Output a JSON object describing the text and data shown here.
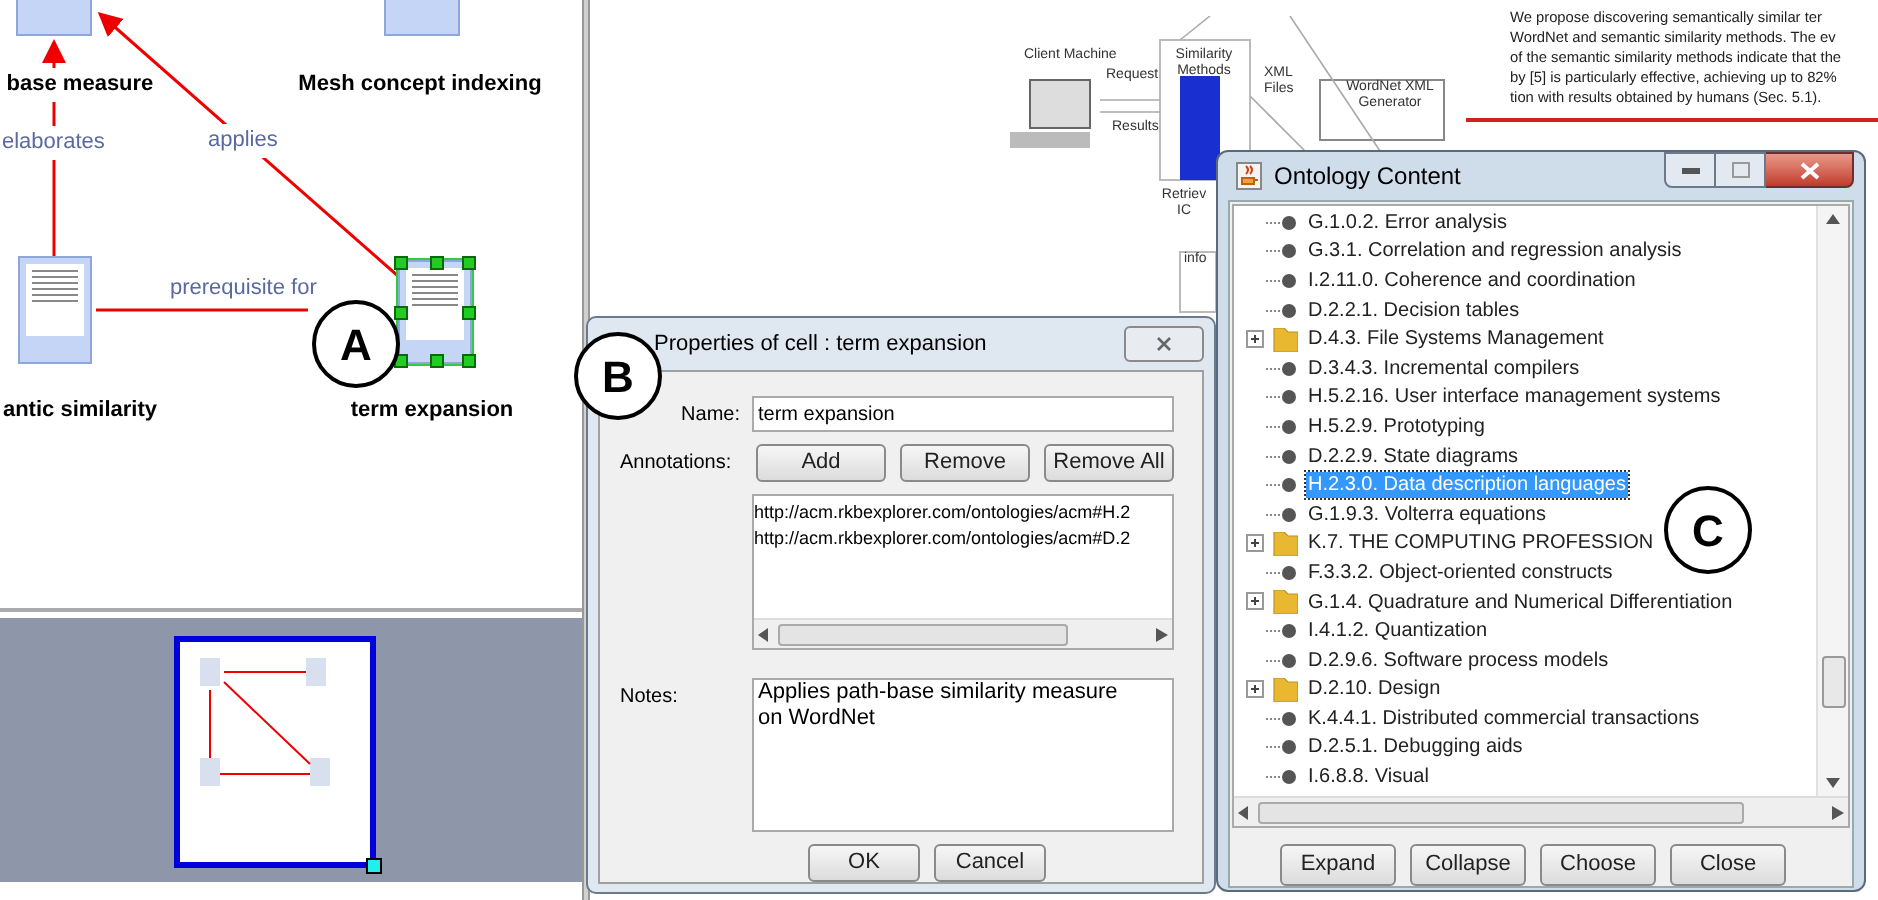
{
  "graph": {
    "nodes": [
      {
        "label": "base measure",
        "selected": false
      },
      {
        "label": "Mesh concept indexing",
        "selected": false
      },
      {
        "label": "antic similarity",
        "selected": false
      },
      {
        "label": "term expansion",
        "selected": true
      }
    ],
    "edges": [
      {
        "label": "elaborates"
      },
      {
        "label": "applies"
      },
      {
        "label": "prerequisite for"
      }
    ]
  },
  "callouts": [
    "A",
    "B",
    "C"
  ],
  "background_document": {
    "diagram_labels": [
      "Client Machine",
      "Request",
      "Results",
      "Similarity Methods",
      "XML Files",
      "WordNet XML Generator",
      "Retriev IC",
      "info"
    ],
    "paragraph_lines": [
      "We propose discovering semantically similar ter",
      "WordNet and semantic similarity methods. The ev",
      "of the semantic similarity methods indicate that the",
      "by [5] is particularly effective, achieving up to 82%",
      "tion with results obtained by humans (Sec. 5.1)."
    ]
  },
  "properties_dialog": {
    "title": "Properties of cell : term expansion",
    "name_label": "Name:",
    "name_value": "term expansion",
    "annotations_label": "Annotations:",
    "annotation_buttons": [
      "Add",
      "Remove",
      "Remove All"
    ],
    "annotations": [
      "http://acm.rkbexplorer.com/ontologies/acm#H.2",
      "http://acm.rkbexplorer.com/ontologies/acm#D.2"
    ],
    "notes_label": "Notes:",
    "notes_value": "Applies path-base similarity measure\non WordNet",
    "buttons": [
      "OK",
      "Cancel"
    ]
  },
  "ontology_window": {
    "title": "Ontology Content",
    "items": [
      {
        "label": "G.1.0.2. Error analysis",
        "kind": "leaf",
        "selected": false
      },
      {
        "label": "G.3.1. Correlation and regression analysis",
        "kind": "leaf",
        "selected": false
      },
      {
        "label": "I.2.11.0. Coherence and coordination",
        "kind": "leaf",
        "selected": false
      },
      {
        "label": "D.2.2.1. Decision tables",
        "kind": "leaf",
        "selected": false
      },
      {
        "label": "D.4.3. File Systems Management",
        "kind": "folder",
        "selected": false
      },
      {
        "label": "D.3.4.3. Incremental compilers",
        "kind": "leaf",
        "selected": false
      },
      {
        "label": "H.5.2.16. User interface management systems",
        "kind": "leaf",
        "selected": false
      },
      {
        "label": "H.5.2.9. Prototyping",
        "kind": "leaf",
        "selected": false
      },
      {
        "label": "D.2.2.9. State diagrams",
        "kind": "leaf",
        "selected": false
      },
      {
        "label": "H.2.3.0. Data description languages",
        "kind": "leaf",
        "selected": true
      },
      {
        "label": "G.1.9.3. Volterra equations",
        "kind": "leaf",
        "selected": false
      },
      {
        "label": "K.7. THE COMPUTING PROFESSION",
        "kind": "folder",
        "selected": false
      },
      {
        "label": "F.3.3.2. Object-oriented constructs",
        "kind": "leaf",
        "selected": false
      },
      {
        "label": "G.1.4. Quadrature and Numerical Differentiation",
        "kind": "folder",
        "selected": false
      },
      {
        "label": "I.4.1.2. Quantization",
        "kind": "leaf",
        "selected": false
      },
      {
        "label": "D.2.9.6. Software process models",
        "kind": "leaf",
        "selected": false
      },
      {
        "label": "D.2.10. Design",
        "kind": "folder",
        "selected": false
      },
      {
        "label": "K.4.4.1. Distributed commercial transactions",
        "kind": "leaf",
        "selected": false
      },
      {
        "label": "D.2.5.1. Debugging aids",
        "kind": "leaf",
        "selected": false
      },
      {
        "label": "I.6.8.8. Visual",
        "kind": "leaf",
        "selected": false
      }
    ],
    "buttons": [
      "Expand",
      "Collapse",
      "Choose",
      "Close"
    ]
  }
}
